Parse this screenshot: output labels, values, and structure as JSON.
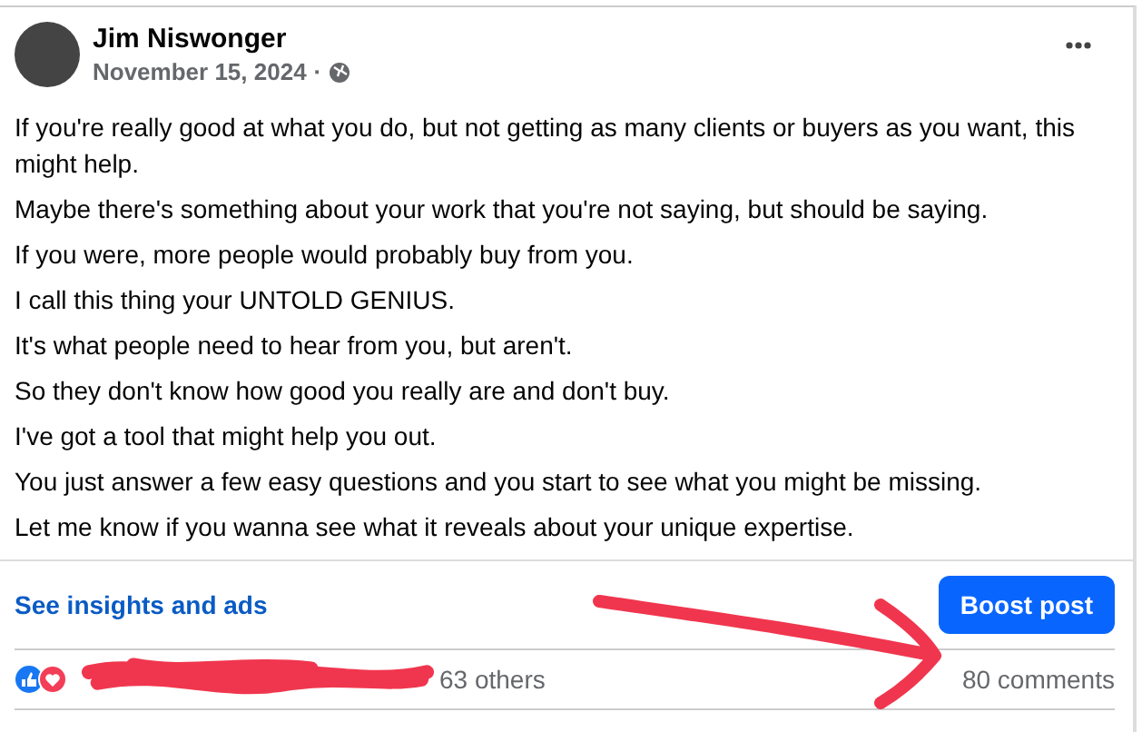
{
  "post": {
    "author": "Jim Niswonger",
    "date": "November 15, 2024",
    "separator": "·",
    "paragraphs": [
      "If you're really good at what you do, but not getting as many clients or buyers as you want, this might help.",
      "Maybe there's something about your work that you're not saying, but should be saying.",
      "If you were, more people would probably buy from you.",
      "I call this thing your UNTOLD GENIUS.",
      "It's what people need to hear from you, but aren't.",
      "So they don't know how good you really are and don't buy.",
      "I've got a tool that might help you out.",
      "You just answer a few easy questions and you start to see what you might be missing.",
      "Let me know if you wanna see what it reveals about your unique expertise."
    ]
  },
  "insights_link": "See insights and ads",
  "boost_button": "Boost post",
  "reactions": {
    "others": "63 others",
    "comments": "80 comments"
  }
}
